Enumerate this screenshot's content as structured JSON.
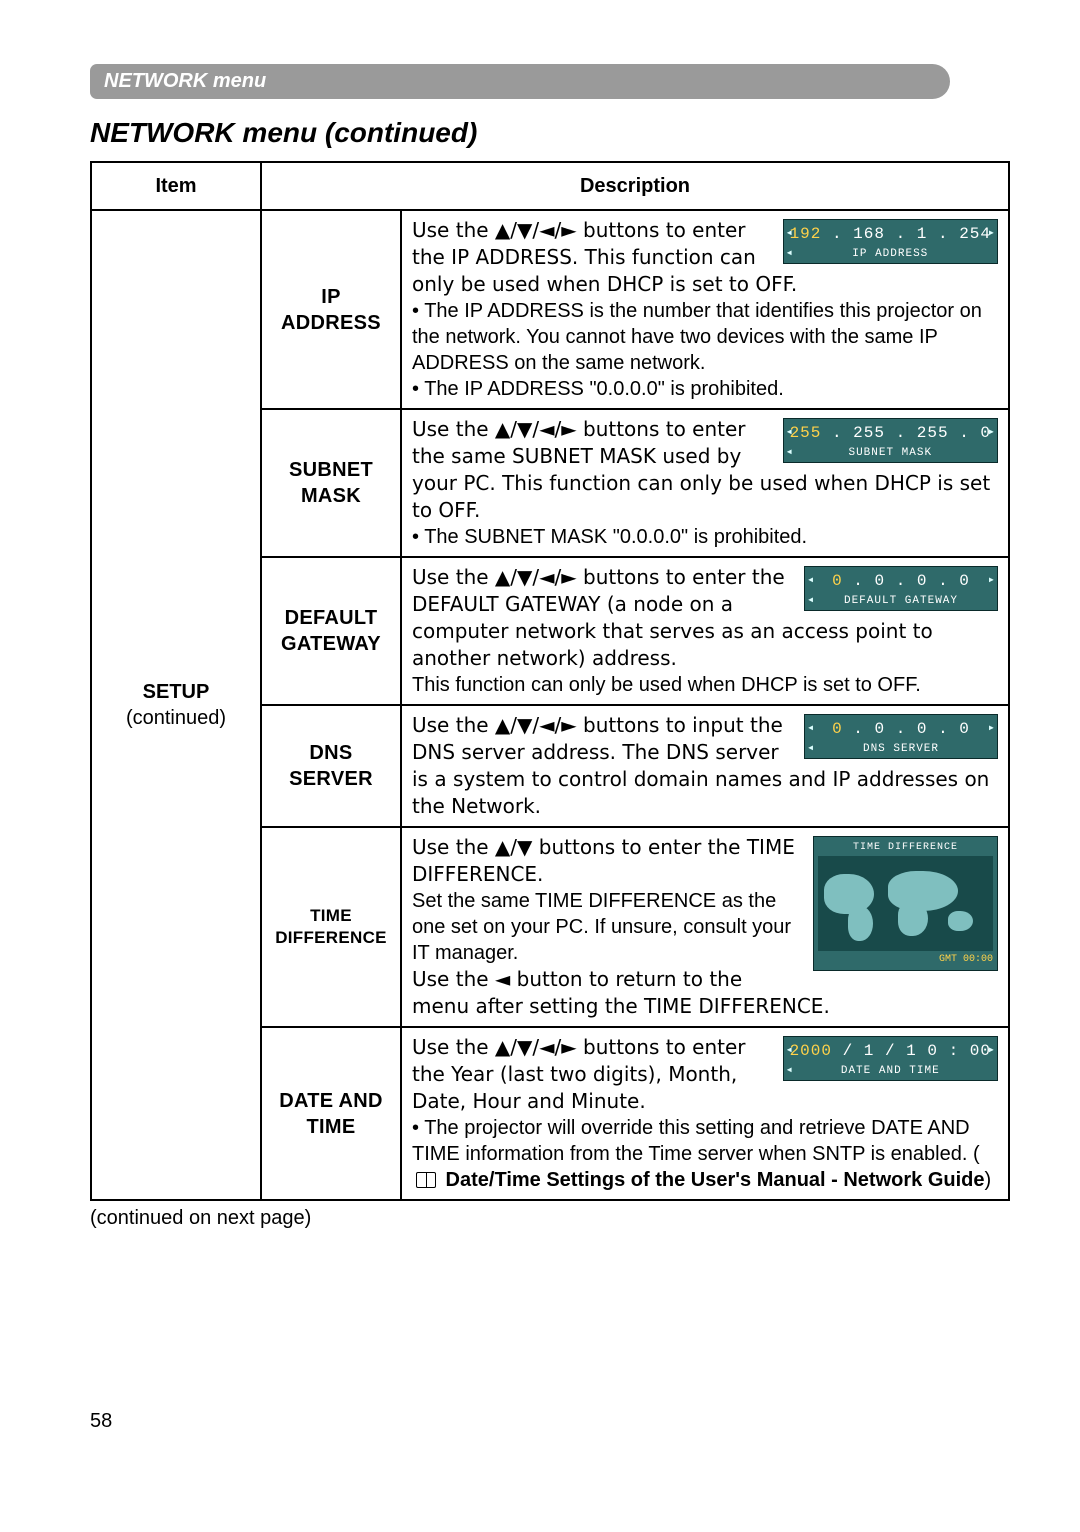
{
  "header": {
    "tab": "NETWORK menu",
    "section_title": "NETWORK menu (continued)"
  },
  "table": {
    "col1": "Item",
    "col2": "Description",
    "group_item": "SETUP",
    "group_item_sub": "(continued)",
    "rows": [
      {
        "name": "IP ADDRESS",
        "desc_lead": "Use the ▲/▼/◄/► buttons to enter the IP ADDRESS. This function can only be used when DHCP is set to OFF.",
        "bullet1": "• The IP ADDRESS is the number that identifies this projector on the network. You cannot have two devices with the same IP ADDRESS on the same network.",
        "bullet2": "• The IP ADDRESS \"0.0.0.0\" is prohibited.",
        "osd": {
          "value_hl": "192",
          "value_rest": " . 168 .   1  . 254",
          "label": "IP ADDRESS"
        }
      },
      {
        "name": "SUBNET MASK",
        "desc_lead": "Use the ▲/▼/◄/► buttons to enter the same SUBNET MASK used by your PC. This function can only be used when DHCP is set to OFF.",
        "bullet1": "• The SUBNET MASK \"0.0.0.0\" is prohibited.",
        "osd": {
          "value_hl": "255",
          "value_rest": " . 255 . 255 .   0",
          "label": "SUBNET MASK"
        }
      },
      {
        "name": "DEFAULT GATEWAY",
        "desc_lead": "Use the ▲/▼/◄/► buttons to enter the DEFAULT GATEWAY (a node on a computer network that serves as an access point to another network) address.",
        "trail": "This function can only be used when DHCP is set to OFF.",
        "osd": {
          "value_hl": "0",
          "value_rest": " .   0  .   0  .   0",
          "label": "DEFAULT GATEWAY"
        }
      },
      {
        "name": "DNS SERVER",
        "desc_lead": "Use the ▲/▼/◄/► buttons to input the DNS server address. The DNS server is a system to control domain names and IP addresses on the Network.",
        "osd": {
          "value_hl": "0",
          "value_rest": " .   0  .   0  .   0",
          "label": "DNS SERVER"
        }
      },
      {
        "name": "TIME DIFFERENCE",
        "desc_lead": "Use the ▲/▼ buttons to enter the TIME DIFFERENCE.",
        "p2": "Set the same TIME DIFFERENCE as the one set on your PC. If unsure, consult your IT manager.",
        "p3": "Use the ◄ button to return to the menu after setting the TIME DIFFERENCE.",
        "map": {
          "title": "TIME DIFFERENCE",
          "gmt": "GMT 00:00"
        }
      },
      {
        "name": "DATE AND TIME",
        "desc_lead": "Use the ▲/▼/◄/► buttons to enter the Year (last two digits), Month, Date, Hour and Minute.",
        "bullet1_a": "• The projector will override this setting and retrieve DATE AND TIME information from the Time server when SNTP is enabled. (",
        "bullet1_b": " Date/Time Settings of the User's Manual - Network Guide",
        "bullet1_c": ")",
        "osd": {
          "value_hl": "2000",
          "value_rest": " /  1  /  1     0  : 00",
          "label": "DATE AND TIME"
        }
      }
    ]
  },
  "continued_note": "(continued on next page)",
  "page_number": "58"
}
